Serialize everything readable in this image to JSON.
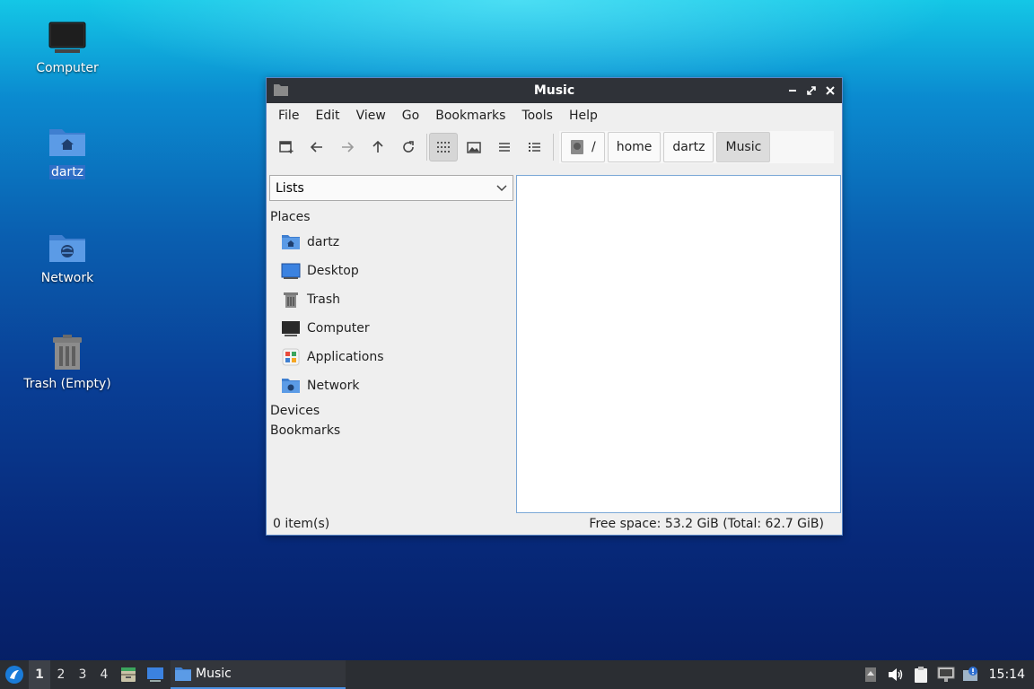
{
  "desktop": {
    "icons": [
      {
        "label": "Computer"
      },
      {
        "label": "dartz"
      },
      {
        "label": "Network"
      },
      {
        "label": "Trash (Empty)"
      }
    ]
  },
  "window": {
    "title": "Music",
    "menu": [
      "File",
      "Edit",
      "View",
      "Go",
      "Bookmarks",
      "Tools",
      "Help"
    ],
    "path": [
      "/",
      "home",
      "dartz",
      "Music"
    ],
    "sidebar": {
      "combo_value": "Lists",
      "places_header": "Places",
      "places": [
        {
          "label": "dartz",
          "icon": "home-folder-icon"
        },
        {
          "label": "Desktop",
          "icon": "desktop-icon"
        },
        {
          "label": "Trash",
          "icon": "trash-icon"
        },
        {
          "label": "Computer",
          "icon": "computer-icon"
        },
        {
          "label": "Applications",
          "icon": "applications-icon"
        },
        {
          "label": "Network",
          "icon": "network-folder-icon"
        }
      ],
      "devices_header": "Devices",
      "bookmarks_header": "Bookmarks"
    },
    "status": {
      "items": "0 item(s)",
      "free_space": "Free space: 53.2 GiB (Total: 62.7 GiB)"
    }
  },
  "taskbar": {
    "workspaces": [
      "1",
      "2",
      "3",
      "4"
    ],
    "active_workspace": "1",
    "task_label": "Music",
    "clock": "15:14"
  },
  "colors": {
    "accent": "#4a90e2",
    "titlebar": "#2f3238",
    "taskbar": "#2b2e33"
  }
}
